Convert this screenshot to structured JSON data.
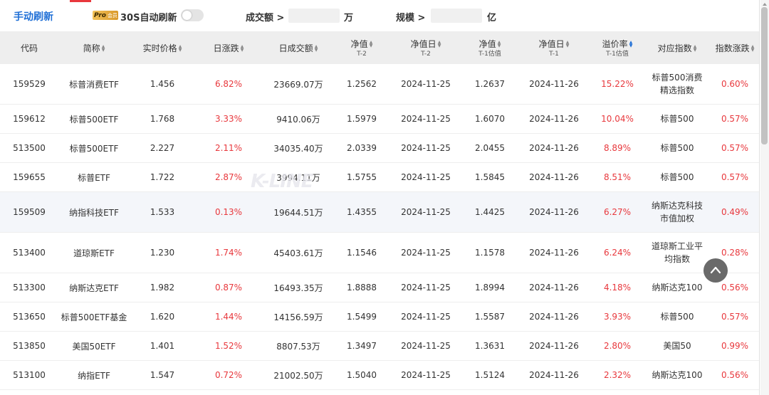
{
  "toolbar": {
    "manual_refresh": "手动刷新",
    "pro_badge": "Pro",
    "pro_badge_sub": "会员",
    "auto_refresh_label": "30S自动刷新",
    "auto_refresh_on": false,
    "volume_label": "成交额 >",
    "volume_value": "",
    "volume_unit": "万",
    "scale_label": "规模 >",
    "scale_value": "",
    "scale_unit": "亿"
  },
  "columns": [
    {
      "label": "代码",
      "sub": "",
      "sort": false
    },
    {
      "label": "简称",
      "sub": "",
      "sort": true
    },
    {
      "label": "实时价格",
      "sub": "",
      "sort": true
    },
    {
      "label": "日涨跌",
      "sub": "",
      "sort": true
    },
    {
      "label": "日成交额",
      "sub": "",
      "sort": true
    },
    {
      "label": "净值",
      "sub": "T-2",
      "sort": true
    },
    {
      "label": "净值日",
      "sub": "T-2",
      "sort": true
    },
    {
      "label": "净值",
      "sub": "T-1估值",
      "sort": true
    },
    {
      "label": "净值日",
      "sub": "T-1",
      "sort": true
    },
    {
      "label": "溢价率",
      "sub": "T-1估值",
      "sort": true,
      "active": true
    },
    {
      "label": "对应指数",
      "sub": "",
      "sort": true
    },
    {
      "label": "指数涨跌",
      "sub": "",
      "sort": true
    }
  ],
  "rows": [
    {
      "code": "159529",
      "name": "标普消费ETF",
      "price": "1.456",
      "change": "6.82%",
      "volume": "23669.07万",
      "nav_t2": "1.2562",
      "nav_date_t2": "2024-11-25",
      "nav_t1": "1.2637",
      "nav_date_t1": "2024-11-26",
      "premium": "15.22%",
      "index": "标普500消费精选指数",
      "index_change": "0.60%"
    },
    {
      "code": "159612",
      "name": "标普500ETF",
      "price": "1.768",
      "change": "3.33%",
      "volume": "9410.06万",
      "nav_t2": "1.5979",
      "nav_date_t2": "2024-11-25",
      "nav_t1": "1.6070",
      "nav_date_t1": "2024-11-26",
      "premium": "10.04%",
      "index": "标普500",
      "index_change": "0.57%"
    },
    {
      "code": "513500",
      "name": "标普500ETF",
      "price": "2.227",
      "change": "2.11%",
      "volume": "34035.40万",
      "nav_t2": "2.0339",
      "nav_date_t2": "2024-11-25",
      "nav_t1": "2.0455",
      "nav_date_t1": "2024-11-26",
      "premium": "8.89%",
      "index": "标普500",
      "index_change": "0.57%"
    },
    {
      "code": "159655",
      "name": "标普ETF",
      "price": "1.722",
      "change": "2.87%",
      "volume": "3994.11万",
      "nav_t2": "1.5755",
      "nav_date_t2": "2024-11-25",
      "nav_t1": "1.5845",
      "nav_date_t1": "2024-11-26",
      "premium": "8.51%",
      "index": "标普500",
      "index_change": "0.57%"
    },
    {
      "code": "159509",
      "name": "纳指科技ETF",
      "price": "1.533",
      "change": "0.13%",
      "volume": "19644.51万",
      "nav_t2": "1.4355",
      "nav_date_t2": "2024-11-25",
      "nav_t1": "1.4425",
      "nav_date_t1": "2024-11-26",
      "premium": "6.27%",
      "index": "纳斯达克科技市值加权",
      "index_change": "0.49%"
    },
    {
      "code": "513400",
      "name": "道琼斯ETF",
      "price": "1.230",
      "change": "1.74%",
      "volume": "45403.61万",
      "nav_t2": "1.1546",
      "nav_date_t2": "2024-11-25",
      "nav_t1": "1.1578",
      "nav_date_t1": "2024-11-26",
      "premium": "6.24%",
      "index": "道琼斯工业平均指数",
      "index_change": "0.28%"
    },
    {
      "code": "513300",
      "name": "纳斯达克ETF",
      "price": "1.982",
      "change": "0.87%",
      "volume": "16493.35万",
      "nav_t2": "1.8888",
      "nav_date_t2": "2024-11-25",
      "nav_t1": "1.8994",
      "nav_date_t1": "2024-11-26",
      "premium": "4.18%",
      "index": "纳斯达克100",
      "index_change": "0.56%"
    },
    {
      "code": "513650",
      "name": "标普500ETF基金",
      "price": "1.620",
      "change": "1.44%",
      "volume": "14156.59万",
      "nav_t2": "1.5499",
      "nav_date_t2": "2024-11-25",
      "nav_t1": "1.5587",
      "nav_date_t1": "2024-11-26",
      "premium": "3.93%",
      "index": "标普500",
      "index_change": "0.57%"
    },
    {
      "code": "513850",
      "name": "美国50ETF",
      "price": "1.401",
      "change": "1.52%",
      "volume": "8807.53万",
      "nav_t2": "1.3497",
      "nav_date_t2": "2024-11-25",
      "nav_t1": "1.3631",
      "nav_date_t1": "2024-11-26",
      "premium": "2.80%",
      "index": "美国50",
      "index_change": "0.99%"
    },
    {
      "code": "513100",
      "name": "纳指ETF",
      "price": "1.547",
      "change": "0.72%",
      "volume": "21002.50万",
      "nav_t2": "1.5040",
      "nav_date_t2": "2024-11-25",
      "nav_t1": "1.5124",
      "nav_date_t1": "2024-11-26",
      "premium": "2.32%",
      "index": "纳斯达克100",
      "index_change": "0.56%"
    }
  ],
  "watermark": "K-LINE",
  "icons": {
    "to_top": "chevron-up-icon",
    "sort": "sort-icon"
  },
  "colors": {
    "accent_blue": "#1f6fd6",
    "rise_red": "#e8383d",
    "header_bg": "#eeeeee"
  }
}
